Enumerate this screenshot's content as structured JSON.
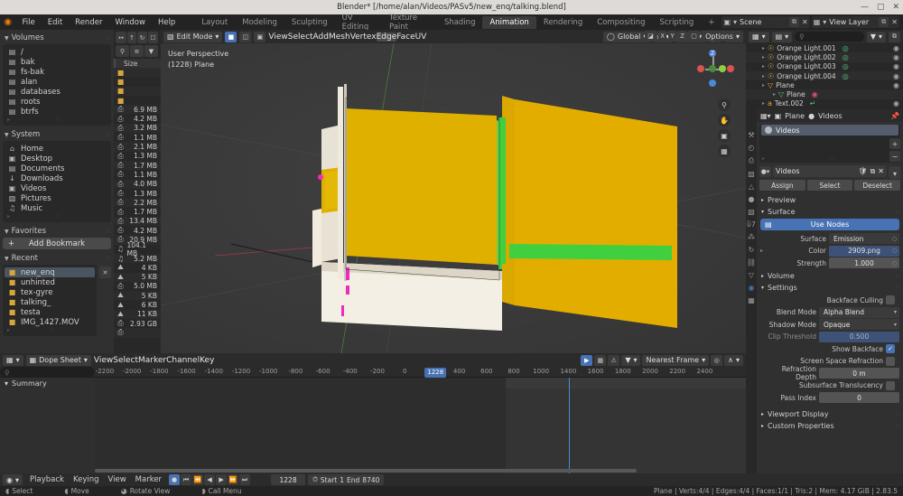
{
  "window": {
    "title": "Blender* [/home/alan/Videos/PASv5/new_enq/talking.blend]",
    "minimize": "—",
    "maximize": "▢",
    "close": "✕"
  },
  "topbar": {
    "logo_icon": "blender-logo-icon",
    "menus": [
      "File",
      "Edit",
      "Render",
      "Window",
      "Help"
    ],
    "workspace_tabs": [
      "Layout",
      "Modeling",
      "Sculpting",
      "UV Editing",
      "Texture Paint",
      "Shading",
      "Animation",
      "Rendering",
      "Compositing",
      "Scripting"
    ],
    "active_workspace": "Animation",
    "add_tab": "+",
    "scene_name": "Scene",
    "view_layer_name": "View Layer",
    "accent": "#4772b3"
  },
  "filebrowser": {
    "nav_icons": [
      "back-arrow-icon",
      "up-arrow-icon",
      "refresh-icon",
      "new-folder-icon"
    ],
    "tool_icons": [
      "search-icon",
      "sort-icon",
      "filter-icon"
    ],
    "sections": [
      {
        "title": "Volumes",
        "items": [
          {
            "label": "/",
            "icon": "disk-icon"
          },
          {
            "label": "bak",
            "icon": "disk-icon"
          },
          {
            "label": "fs-bak",
            "icon": "disk-icon"
          },
          {
            "label": "alan",
            "icon": "disk-icon"
          },
          {
            "label": "databases",
            "icon": "disk-icon"
          },
          {
            "label": "roots",
            "icon": "disk-icon"
          },
          {
            "label": "btrfs",
            "icon": "disk-icon"
          }
        ]
      },
      {
        "title": "System",
        "items": [
          {
            "label": "Home",
            "icon": "home-icon"
          },
          {
            "label": "Desktop",
            "icon": "desktop-icon"
          },
          {
            "label": "Documents",
            "icon": "documents-icon"
          },
          {
            "label": "Downloads",
            "icon": "downloads-icon"
          },
          {
            "label": "Videos",
            "icon": "videos-icon"
          },
          {
            "label": "Pictures",
            "icon": "pictures-icon"
          },
          {
            "label": "Music",
            "icon": "music-icon"
          }
        ]
      },
      {
        "title": "Favorites",
        "add_bookmark": "Add Bookmark",
        "add_bookmark_icon": "plus-icon"
      },
      {
        "title": "Recent",
        "close_icon": "close-icon",
        "items": [
          {
            "label": "new_enq",
            "icon": "folder-icon",
            "selected": true
          },
          {
            "label": "unhinted",
            "icon": "folder-icon",
            "selected": false
          },
          {
            "label": "tex-gyre",
            "icon": "folder-icon",
            "selected": false
          },
          {
            "label": "talking_",
            "icon": "folder-icon",
            "selected": false
          },
          {
            "label": "testa",
            "icon": "folder-icon",
            "selected": false
          },
          {
            "label": "IMG_1427.MOV",
            "icon": "folder-icon",
            "selected": false
          }
        ]
      }
    ],
    "column_header": "Size",
    "files": [
      {
        "size": "",
        "kind": "folder"
      },
      {
        "size": "",
        "kind": "folder"
      },
      {
        "size": "",
        "kind": "folder"
      },
      {
        "size": "",
        "kind": "folder"
      },
      {
        "size": "6.9 MB",
        "kind": "movie"
      },
      {
        "size": "4.2 MB",
        "kind": "movie"
      },
      {
        "size": "3.2 MB",
        "kind": "movie"
      },
      {
        "size": "1.1 MB",
        "kind": "movie"
      },
      {
        "size": "2.1 MB",
        "kind": "movie"
      },
      {
        "size": "1.3 MB",
        "kind": "movie"
      },
      {
        "size": "1.7 MB",
        "kind": "movie"
      },
      {
        "size": "1.1 MB",
        "kind": "movie"
      },
      {
        "size": "4.0 MB",
        "kind": "movie"
      },
      {
        "size": "1.3 MB",
        "kind": "movie"
      },
      {
        "size": "2.2 MB",
        "kind": "movie"
      },
      {
        "size": "1.7 MB",
        "kind": "movie"
      },
      {
        "size": "13.4 MB",
        "kind": "movie"
      },
      {
        "size": "4.2 MB",
        "kind": "movie"
      },
      {
        "size": "20.9 MB",
        "kind": "movie"
      },
      {
        "size": "104.1 MB",
        "kind": "audio"
      },
      {
        "size": "5.2 MB",
        "kind": "audio"
      },
      {
        "size": "4 KB",
        "kind": "image"
      },
      {
        "size": "5 KB",
        "kind": "image"
      },
      {
        "size": "5.0 MB",
        "kind": "movie"
      },
      {
        "size": "5 KB",
        "kind": "image"
      },
      {
        "size": "6 KB",
        "kind": "image"
      },
      {
        "size": "11 KB",
        "kind": "image"
      },
      {
        "size": "2.93 GB",
        "kind": "movie"
      },
      {
        "size": "",
        "kind": "movie"
      }
    ]
  },
  "viewport": {
    "mode": "Edit Mode",
    "mode_icon": "edit-mode-icon",
    "select_modes": [
      "vertex-select-icon",
      "edge-select-icon",
      "face-select-icon"
    ],
    "active_select_mode": "vertex-select-icon",
    "menus": [
      "View",
      "Select",
      "Add",
      "Mesh",
      "Vertex",
      "Edge",
      "Face",
      "UV"
    ],
    "active_menu": "Edge",
    "transform_orientation": "Global",
    "orientation_icon": "orientation-icon",
    "pivot_icon": "pivot-icon",
    "snap_icon": "snap-magnet-icon",
    "proportional_icon": "proportional-edit-icon",
    "falloff_icon": "falloff-curve-icon",
    "mirror_icon": "mirror-icon",
    "mirror_axes": [
      "X",
      "Y",
      "Z"
    ],
    "options_label": "Options",
    "overlay_line1": "User Perspective",
    "overlay_line2": "(1228) Plane",
    "nav_buttons": [
      "zoom-icon",
      "hand-pan-icon",
      "camera-view-icon",
      "ortho-persp-icon"
    ],
    "gizmo_axes": [
      {
        "label": "Z",
        "color": "#5680d6"
      },
      {
        "label": "Y",
        "color": "#8fce3e"
      },
      {
        "label": "X",
        "color": "#d9534f"
      }
    ]
  },
  "outliner": {
    "display_mode_icon": "outliner-icon",
    "filter_icon": "filter-icon",
    "new_collection_icon": "new-collection-icon",
    "search_placeholder": "",
    "search_icon": "search-icon",
    "rows": [
      {
        "label": "Orange Light.001",
        "icon": "light-icon",
        "data_icon": "light-data-icon",
        "indent": 12,
        "eye": "eye-icon"
      },
      {
        "label": "Orange Light.002",
        "icon": "light-icon",
        "data_icon": "light-data-icon",
        "indent": 12,
        "eye": "eye-icon"
      },
      {
        "label": "Orange Light.003",
        "icon": "light-icon",
        "data_icon": "light-data-icon",
        "indent": 12,
        "eye": "eye-icon"
      },
      {
        "label": "Orange Light.004",
        "icon": "light-icon",
        "data_icon": "light-data-icon",
        "indent": 12,
        "eye": "eye-icon"
      },
      {
        "label": "Plane",
        "icon": "mesh-object-icon",
        "data_icon": "",
        "indent": 12,
        "eye": "eye-icon"
      },
      {
        "label": "Plane",
        "icon": "mesh-data-icon",
        "data_icon": "material-icon",
        "indent": 24,
        "eye": ""
      },
      {
        "label": "Text.002",
        "icon": "font-object-icon",
        "data_icon": "font-data-icon",
        "indent": 12,
        "eye": "eye-icon"
      }
    ]
  },
  "properties": {
    "tab_icons": [
      "tool-icon",
      "render-icon",
      "output-icon",
      "viewlayer-icon",
      "scene-icon",
      "world-icon",
      "object-icon",
      "modifier-icon",
      "particles-icon",
      "physics-icon",
      "constraint-icon",
      "data-icon",
      "material-icon",
      "texture-icon"
    ],
    "active_tab": "material-icon",
    "breadcrumb_object": "Plane",
    "breadcrumb_material": "Videos",
    "breadcrumb_object_icon": "object-icon",
    "breadcrumb_material_icon": "material-ball-icon",
    "pin_icon": "pin-icon",
    "material_slot": "Videos",
    "slot_buttons": [
      "plus-icon",
      "minus-icon",
      "chevron-down-icon"
    ],
    "material_name": "Videos",
    "name_buttons": [
      "shield-icon",
      "copy-icon",
      "x-icon"
    ],
    "node_tree_icon": "node-tree-icon",
    "assign_label": "Assign",
    "select_label": "Select",
    "deselect_label": "Deselect",
    "sections": {
      "preview": "Preview",
      "surface": "Surface",
      "volume": "Volume",
      "settings": "Settings",
      "viewport_display": "Viewport Display",
      "custom_properties": "Custom Properties"
    },
    "use_nodes": "Use Nodes",
    "use_nodes_icon": "nodes-icon",
    "surface_fields": [
      {
        "label": "Surface",
        "value": "Emission",
        "style": "dark"
      },
      {
        "label": "Color",
        "value": "2909.png",
        "style": "blue"
      },
      {
        "label": "Strength",
        "value": "1.000",
        "style": "plain"
      }
    ],
    "settings_fields": [
      {
        "label": "Backface Culling",
        "type": "checkbox",
        "value": false
      },
      {
        "label": "Blend Mode",
        "type": "dropdown",
        "value": "Alpha Blend"
      },
      {
        "label": "Shadow Mode",
        "type": "dropdown",
        "value": "Opaque"
      },
      {
        "label": "Clip Threshold",
        "type": "slider",
        "value": "0.500"
      },
      {
        "label": "Show Backface",
        "type": "checkbox",
        "value": true
      },
      {
        "label": "Screen Space Refraction",
        "type": "checkbox",
        "value": false
      },
      {
        "label": "Refraction Depth",
        "type": "value",
        "value": "0 m"
      },
      {
        "label": "Subsurface Translucency",
        "type": "checkbox",
        "value": false
      },
      {
        "label": "Pass Index",
        "type": "value",
        "value": "0"
      }
    ]
  },
  "dopesheet": {
    "editor_icon": "dopesheet-icon",
    "mode": "Dope Sheet",
    "menus": [
      "View",
      "Select",
      "Marker",
      "Channel",
      "Key"
    ],
    "filter_icons": [
      "only-selected-icon",
      "show-hidden-icon",
      "show-errors-icon",
      "filter-icon"
    ],
    "snap_label": "Nearest Frame",
    "proportional_icon": "proportional-edit-icon",
    "falloff_icon": "falloff-curve-icon",
    "search_placeholder": "",
    "search_icon": "search-icon",
    "ticks": [
      "-2200",
      "-2000",
      "-1800",
      "-1600",
      "-1400",
      "-1200",
      "-1000",
      "-800",
      "-600",
      "-400",
      "-200",
      "0",
      "200",
      "400",
      "600",
      "800",
      "1000",
      "1400",
      "1600",
      "1800",
      "2000",
      "2200",
      "2400"
    ],
    "current_frame": "1228",
    "channels": [
      "Summary"
    ]
  },
  "timeline_footer": {
    "playback_icon": "playback-icon",
    "menus": [
      "Playback",
      "Keying",
      "View",
      "Marker"
    ],
    "transport": [
      "record-icon",
      "jump-start-icon",
      "prev-keyframe-icon",
      "play-reverse-icon",
      "play-icon",
      "next-keyframe-icon",
      "jump-end-icon"
    ],
    "current_frame": "1228",
    "range_icon": "preview-range-icon",
    "start_label": "Start",
    "start_value": "1",
    "end_label": "End",
    "end_value": "8740"
  },
  "statusbar": {
    "hints": [
      {
        "mouse": "left-mouse-icon",
        "label": "Select"
      },
      {
        "mouse": "left-mouse-icon",
        "label": "Move"
      },
      {
        "mouse": "middle-mouse-icon",
        "label": "Rotate View"
      },
      {
        "mouse": "right-mouse-icon",
        "label": "Call Menu"
      }
    ],
    "stats": "Plane | Verts:4/4 | Edges:4/4 | Faces:1/1 | Tris:2 | Mem: 4.17 GiB | 2.83.5"
  }
}
